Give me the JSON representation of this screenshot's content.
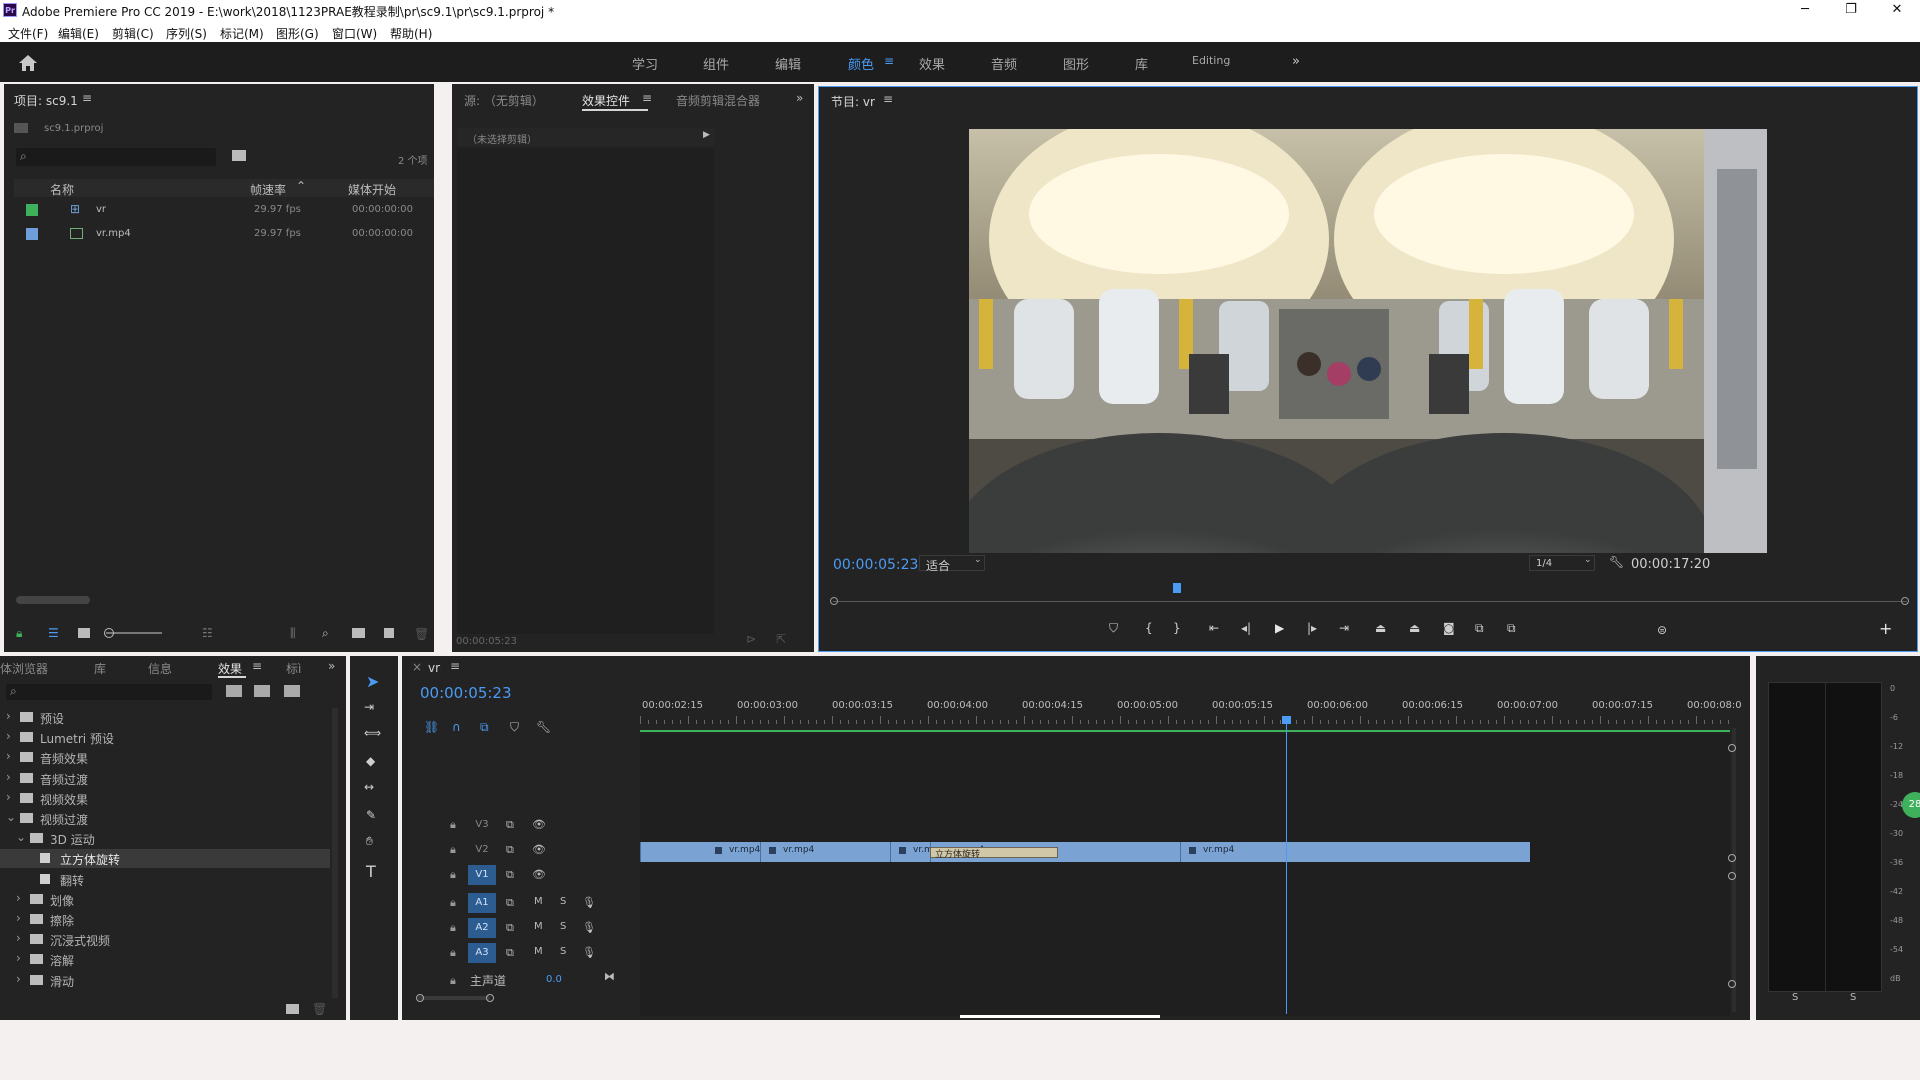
{
  "window": {
    "app_icon": "Pr",
    "title": "Adobe Premiere Pro CC 2019 - E:\\work\\2018\\1123PRAE教程录制\\pr\\sc9.1\\pr\\sc9.1.prproj *",
    "controls": [
      "─",
      "❐",
      "✕"
    ]
  },
  "menu": [
    "文件(F)",
    "编辑(E)",
    "剪辑(C)",
    "序列(S)",
    "标记(M)",
    "图形(G)",
    "窗口(W)",
    "帮助(H)"
  ],
  "workspaces": [
    "学习",
    "组件",
    "编辑",
    "颜色",
    "效果",
    "音频",
    "图形",
    "库",
    "Editing"
  ],
  "workspace_active": "颜色",
  "workspace_overflow": "»",
  "project": {
    "title": "项目: sc9.1",
    "file": "sc9.1.prproj",
    "count": "2 个项",
    "col_name": "名称",
    "col_fps": "帧速率",
    "col_start": "媒体开始",
    "items": [
      {
        "name": "vr",
        "fps": "29.97 fps",
        "start": "00:00:00:00",
        "swatch": "#3fb05b",
        "icon": "sequence-icon"
      },
      {
        "name": "vr.mp4",
        "fps": "29.97 fps",
        "start": "00:00:00:00",
        "swatch": "#6f9fd8",
        "icon": "video-file-icon"
      }
    ]
  },
  "effect_controls": {
    "tab_source": "源: （无剪辑）",
    "tab_effects": "效果控件",
    "tab_mixer": "音频剪辑混合器",
    "no_clip": "（未选择剪辑）",
    "timecode": "00:00:05:23"
  },
  "program": {
    "title": "节目: vr",
    "timecode": "00:00:05:23",
    "fit": "适合",
    "resolution": "1/4",
    "duration": "00:00:17:20",
    "playhead_fraction": 0.32
  },
  "effects_panel": {
    "tabs": [
      "体浏览器",
      "库",
      "信息",
      "效果",
      "标ì"
    ],
    "active_tab": "效果",
    "tree": [
      {
        "label": "预设",
        "level": 0,
        "arrow": "›"
      },
      {
        "label": "Lumetri 预设",
        "level": 0,
        "arrow": "›"
      },
      {
        "label": "音频效果",
        "level": 0,
        "arrow": "›"
      },
      {
        "label": "音频过渡",
        "level": 0,
        "arrow": "›"
      },
      {
        "label": "视频效果",
        "level": 0,
        "arrow": "›"
      },
      {
        "label": "视频过渡",
        "level": 0,
        "arrow": "⌄"
      },
      {
        "label": "3D 运动",
        "level": 1,
        "arrow": "⌄"
      },
      {
        "label": "立方体旋转",
        "level": 2,
        "arrow": "",
        "selected": true
      },
      {
        "label": "翻转",
        "level": 2,
        "arrow": ""
      },
      {
        "label": "划像",
        "level": 1,
        "arrow": "›"
      },
      {
        "label": "擦除",
        "level": 1,
        "arrow": "›"
      },
      {
        "label": "沉浸式视频",
        "level": 1,
        "arrow": "›"
      },
      {
        "label": "溶解",
        "level": 1,
        "arrow": "›"
      },
      {
        "label": "滑动",
        "level": 1,
        "arrow": "›"
      }
    ]
  },
  "timeline": {
    "tab": "vr",
    "timecode": "00:00:05:23",
    "ruler": [
      "00:00:02:15",
      "00:00:03:00",
      "00:00:03:15",
      "00:00:04:00",
      "00:00:04:15",
      "00:00:05:00",
      "00:00:05:15",
      "00:00:06:00",
      "00:00:06:15",
      "00:00:07:00",
      "00:00:07:15",
      "00:00:08:0"
    ],
    "video_tracks": [
      "V3",
      "V2",
      "V1"
    ],
    "audio_tracks": [
      "A1",
      "A2",
      "A3"
    ],
    "master_label": "主声道",
    "master_value": "0.0",
    "m": "M",
    "s": "S",
    "clips": [
      {
        "label": "vr.mp4"
      },
      {
        "label": "vr.mp4"
      },
      {
        "label": "vr.m"
      },
      {
        "label": "vr.mp4"
      },
      {
        "label": "vr.mp4"
      }
    ],
    "transition": "立方体旋转"
  },
  "audio_meter": {
    "scale": [
      "0",
      "-6",
      "-12",
      "-18",
      "-24",
      "-30",
      "-36",
      "-42",
      "-48",
      "-54",
      "dB"
    ],
    "solo": [
      "S",
      "S"
    ],
    "badge": "28"
  }
}
